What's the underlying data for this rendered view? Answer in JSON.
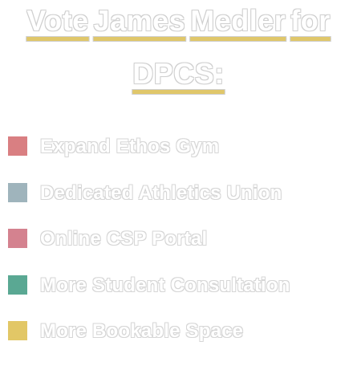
{
  "heading": {
    "line1_words": [
      "Vote",
      "James",
      "Medler",
      "for"
    ],
    "line2_words": [
      "DPCS:"
    ],
    "underline_color": "#e0c76a"
  },
  "items": [
    {
      "label": "Expand Ethos Gym",
      "color": "#d97f82"
    },
    {
      "label": "Dedicated Athletics Union",
      "color": "#9fb4bc"
    },
    {
      "label": "Online CSP Portal",
      "color": "#d4828f"
    },
    {
      "label": "More Student Consultation",
      "color": "#5aa893"
    },
    {
      "label": "More Bookable Space",
      "color": "#e2c766"
    }
  ]
}
